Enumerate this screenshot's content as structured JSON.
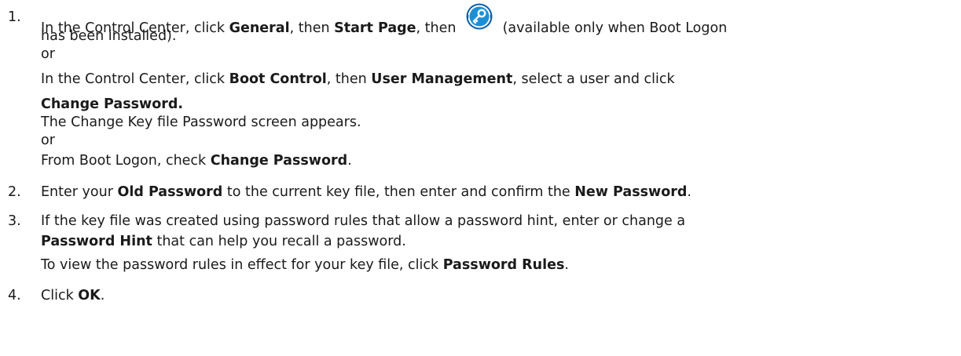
{
  "steps": [
    {
      "number": "1.",
      "lines": [
        {
          "t1": "In the Control Center, click ",
          "b1": "General",
          "t2": ", then ",
          "b2": "Start Page",
          "t3": ", then ",
          "icon": "key-icon",
          "t4": " (available only when Boot Logon"
        },
        {
          "text": "has been installed)."
        },
        {
          "text": "or"
        },
        {
          "t1": "In the Control Center, click ",
          "b1": "Boot Control",
          "t2": ", then ",
          "b2": "User Management",
          "t3": ", select a user and click"
        },
        {
          "bold": "Change Password."
        },
        {
          "text": "The Change Key file Password screen appears."
        },
        {
          "text": "or"
        },
        {
          "t1": "From Boot Logon, check ",
          "b1": "Change Password",
          "t2": "."
        }
      ]
    },
    {
      "number": "2.",
      "lines": [
        {
          "t1": "Enter your ",
          "b1": "Old Password",
          "t2": " to the current key file, then enter and confirm the ",
          "b2": "New Password",
          "t3": "."
        }
      ]
    },
    {
      "number": "3.",
      "lines": [
        {
          "text": "If the key file was created using password rules that allow a password hint, enter or change a"
        },
        {
          "b1": "Password Hint",
          "t1": " that can help you recall a password."
        },
        {
          "t1": "To view the password rules in effect for your key file, click ",
          "b1": "Password Rules",
          "t2": "."
        }
      ]
    },
    {
      "number": "4.",
      "lines": [
        {
          "t1": "Click ",
          "b1": "OK",
          "t2": "."
        }
      ]
    }
  ],
  "colors": {
    "text": "#1a1a1a",
    "icon_blue": "#1b8fd6",
    "icon_ring": "#0a5ea8"
  }
}
